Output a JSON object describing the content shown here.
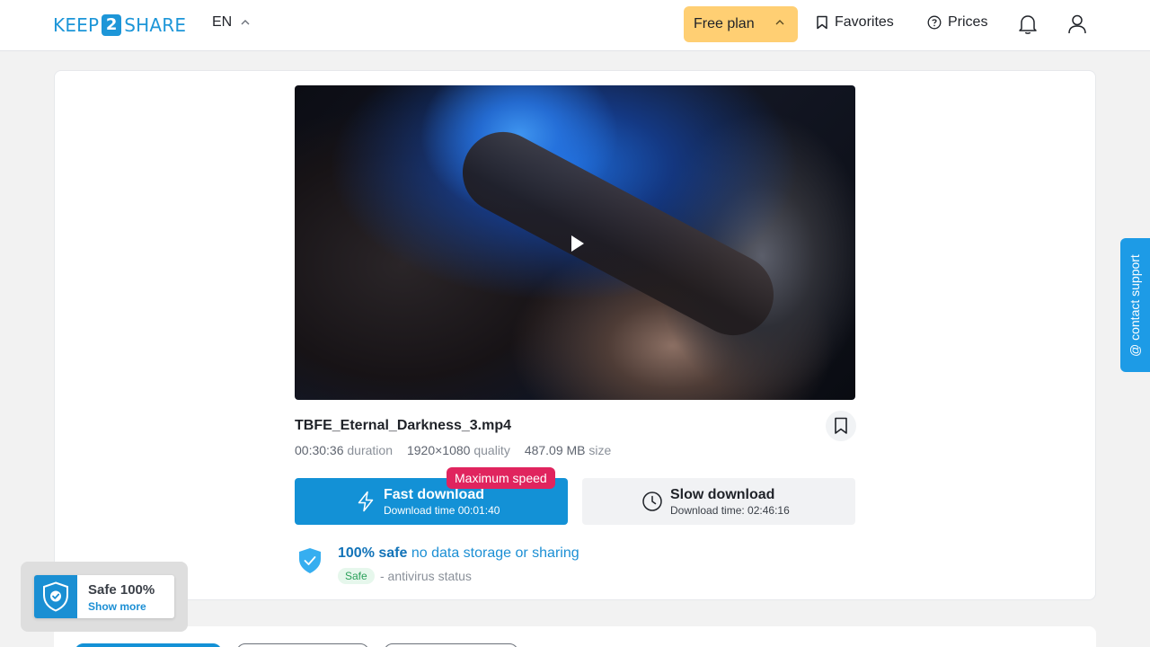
{
  "header": {
    "logo_left": "KEEP",
    "logo_num": "2",
    "logo_right": "SHARE",
    "lang": "EN",
    "free_plan": "Free plan",
    "favorites": "Favorites",
    "prices": "Prices"
  },
  "file": {
    "name": "TBFE_Eternal_Darkness_3.mp4",
    "duration_value": "00:30:36",
    "duration_label": "duration",
    "quality_value": "1920×1080",
    "quality_label": "quality",
    "size_value": "487.09 MB",
    "size_label": "size"
  },
  "download": {
    "fast_label": "Fast download",
    "fast_time": "Download time 00:01:40",
    "max_badge": "Maximum speed",
    "slow_label": "Slow download",
    "slow_time": "Download time: 02:46:16"
  },
  "safety": {
    "strong": "100% safe",
    "rest": " no data storage or sharing",
    "tag": "Safe",
    "status": "- antivirus status"
  },
  "contact": "@ contact support",
  "popup": {
    "title": "Safe 100%",
    "more": "Show more"
  },
  "colors": {
    "accent": "#1391d6",
    "free_plan_bg": "#ffcf73",
    "badge_red": "#e0245e"
  }
}
